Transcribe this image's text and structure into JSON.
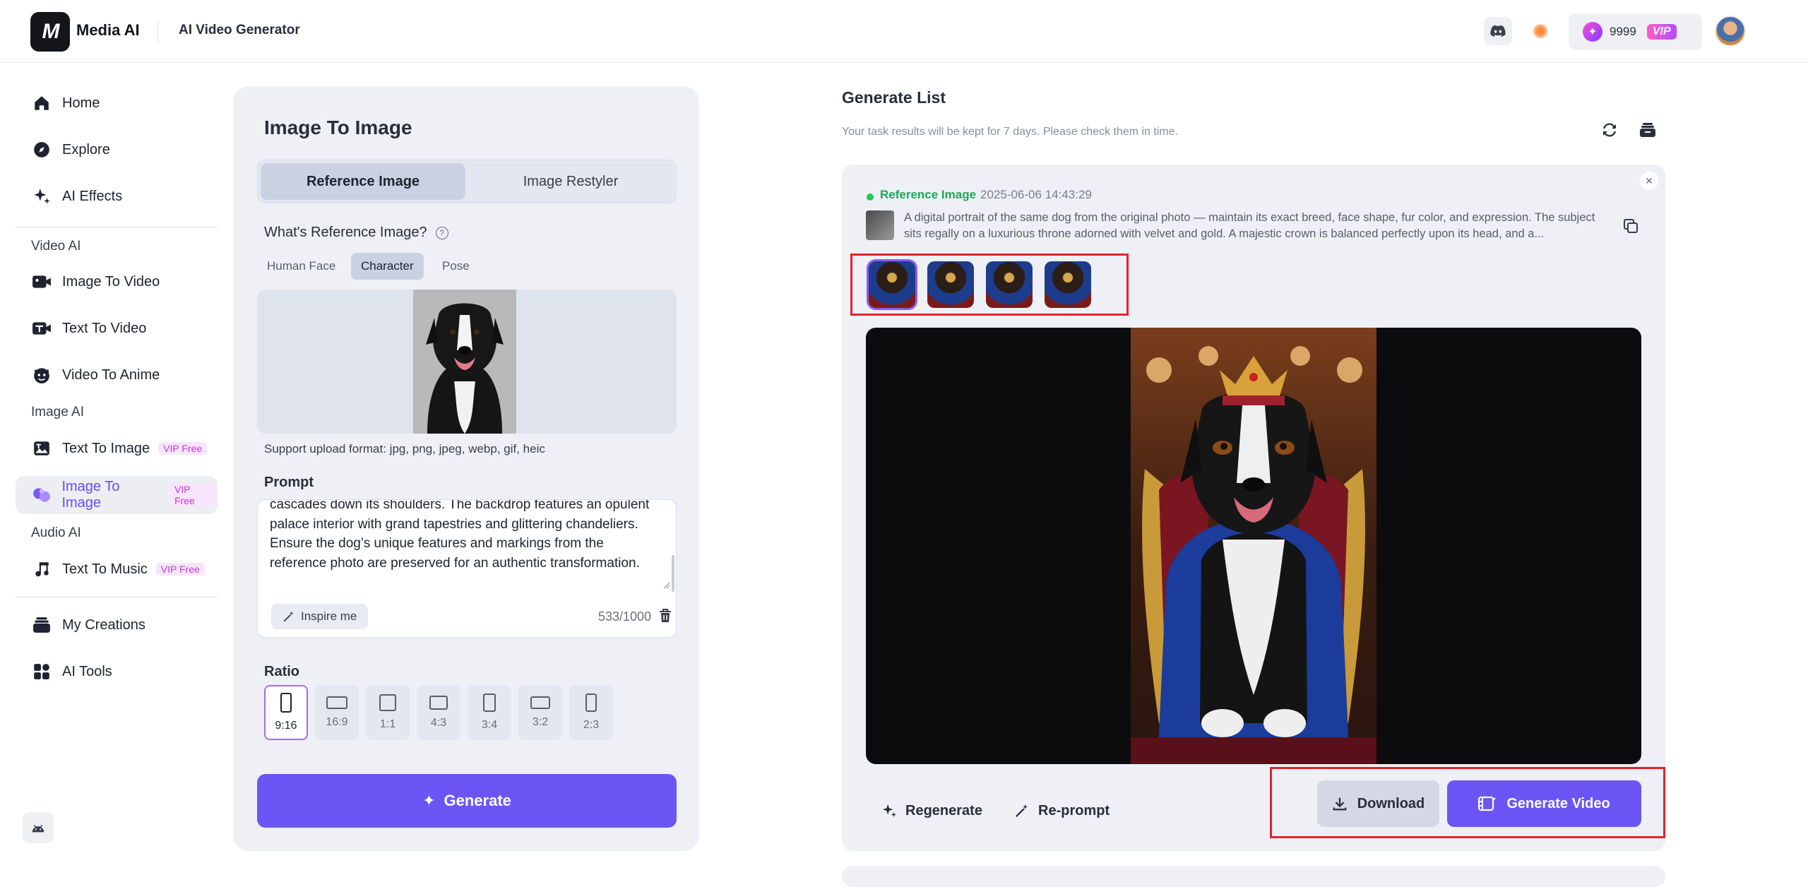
{
  "brand": {
    "logo_mark": "M",
    "name": "Media AI",
    "app_title": "AI Video Generator"
  },
  "topbar": {
    "credits": "9999",
    "vip_label": "VIP",
    "icons": [
      "discord-icon",
      "notification-dot",
      "gem-icon",
      "avatar"
    ]
  },
  "sidebar": {
    "items": [
      {
        "label": "Home",
        "icon": "home-icon"
      },
      {
        "label": "Explore",
        "icon": "compass-icon"
      },
      {
        "label": "AI Effects",
        "icon": "sparkles-icon"
      }
    ],
    "section_video": "Video AI",
    "video_items": [
      {
        "label": "Image To Video",
        "icon": "image-video-icon"
      },
      {
        "label": "Text To Video",
        "icon": "text-video-icon"
      },
      {
        "label": "Video To Anime",
        "icon": "anime-face-icon"
      }
    ],
    "section_image": "Image AI",
    "image_items": [
      {
        "label": "Text To Image",
        "badge": "VIP Free",
        "icon": "text-image-icon"
      },
      {
        "label": "Image To Image",
        "badge": "VIP Free",
        "icon": "image-image-icon",
        "active": true
      }
    ],
    "section_audio": "Audio AI",
    "audio_items": [
      {
        "label": "Text To Music",
        "badge": "VIP Free",
        "icon": "music-note-icon"
      }
    ],
    "bottom_items": [
      {
        "label": "My Creations",
        "icon": "stack-icon"
      },
      {
        "label": "AI Tools",
        "icon": "grid-icon"
      }
    ]
  },
  "panel": {
    "title": "Image To Image",
    "tabs": [
      {
        "label": "Reference Image",
        "active": true
      },
      {
        "label": "Image Restyler",
        "active": false
      }
    ],
    "ref_question": "What's Reference Image?",
    "ref_types": [
      {
        "label": "Human Face"
      },
      {
        "label": "Character",
        "active": true
      },
      {
        "label": "Pose"
      }
    ],
    "support_text": "Support upload format: jpg, png, jpeg, webp, gif, heic",
    "prompt_label": "Prompt",
    "prompt_value": "cascades down its shoulders. The backdrop features an opulent palace interior with grand tapestries and glittering chandeliers. Ensure the dog’s unique features and markings from the reference photo are preserved for an authentic transformation.",
    "inspire_label": "Inspire me",
    "counter": "533/1000",
    "ratio_label": "Ratio",
    "ratios": [
      "9:16",
      "16:9",
      "1:1",
      "4:3",
      "3:4",
      "3:2",
      "2:3"
    ],
    "selected_ratio": "9:16",
    "generate_label": "Generate"
  },
  "generate_list": {
    "title": "Generate List",
    "subtitle": "Your task results will be kept for 7 days. Please check them in time.",
    "task": {
      "type": "Reference Image",
      "time": "2025-06-06 14:43:29",
      "prompt": "A digital portrait of the same dog from the original photo — maintain its exact breed, face shape, fur color, and expression. The subject sits regally on a luxurious throne adorned with velvet and gold. A majestic crown is balanced perfectly upon its head, and a...",
      "results_count": 4,
      "selected_result": 1
    },
    "actions": {
      "regenerate": "Regenerate",
      "reprompt": "Re-prompt",
      "download": "Download",
      "generate_video": "Generate Video"
    }
  }
}
